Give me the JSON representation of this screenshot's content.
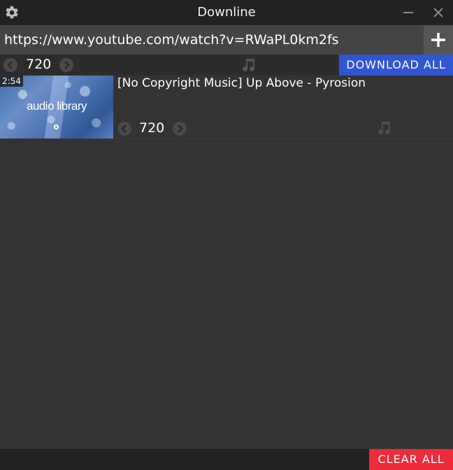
{
  "window": {
    "title": "Downline",
    "settings_icon": "gear-icon",
    "minimize_icon": "minimize-icon",
    "close_icon": "close-icon"
  },
  "url_bar": {
    "value": "https://www.youtube.com/watch?v=RWaPL0km2fs",
    "add_icon": "plus-icon"
  },
  "global_controls": {
    "quality": "720",
    "prev_icon": "chevron-left-icon",
    "next_icon": "chevron-right-icon",
    "audio_icon": "music-note-icon",
    "download_all_label": "DOWNLOAD ALL"
  },
  "videos": [
    {
      "title": "[No Copyright Music] Up Above - Pyrosion",
      "duration": "2:54",
      "thumbnail_text": "audio library",
      "quality": "720",
      "audio_icon": "music-note-icon"
    }
  ],
  "footer": {
    "clear_all_label": "CLEAR ALL"
  },
  "colors": {
    "background": "#333333",
    "titlebar": "#222222",
    "download_all": "#3056d3",
    "clear_all": "#ee2b3b"
  }
}
